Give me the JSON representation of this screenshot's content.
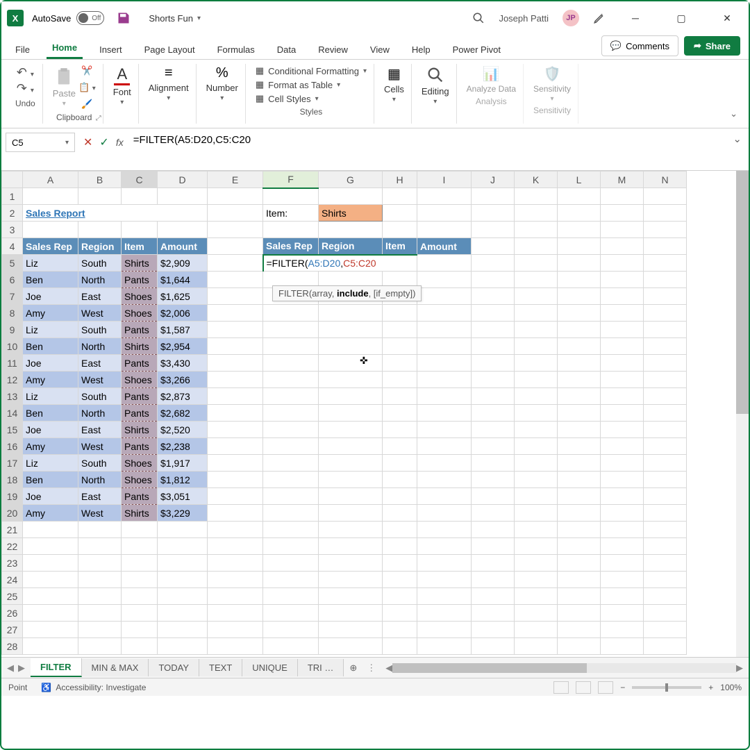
{
  "titlebar": {
    "autosave_label": "AutoSave",
    "autosave_state": "Off",
    "doc_name": "Shorts Fun",
    "user_name": "Joseph Patti",
    "user_initials": "JP"
  },
  "tabs": {
    "items": [
      "File",
      "Home",
      "Insert",
      "Page Layout",
      "Formulas",
      "Data",
      "Review",
      "View",
      "Help",
      "Power Pivot"
    ],
    "active": "Home",
    "comments": "Comments",
    "share": "Share"
  },
  "ribbon": {
    "undo": "Undo",
    "clipboard": "Clipboard",
    "paste": "Paste",
    "font": "Font",
    "alignment": "Alignment",
    "number": "Number",
    "styles": "Styles",
    "cond_format": "Conditional Formatting",
    "format_table": "Format as Table",
    "cell_styles": "Cell Styles",
    "cells": "Cells",
    "editing": "Editing",
    "analyze": "Analyze Data",
    "analysis": "Analysis",
    "sensitivity": "Sensitivity"
  },
  "formula_bar": {
    "name_box": "C5",
    "formula_prefix": "=FILTER(",
    "formula_arg1": "A5:D20",
    "formula_comma": ",",
    "formula_arg2": "C5:C20",
    "tooltip_fn": "FILTER",
    "tooltip_sig_pre": "(array, ",
    "tooltip_sig_bold": "include",
    "tooltip_sig_post": ", [if_empty])"
  },
  "grid": {
    "columns": [
      "A",
      "B",
      "C",
      "D",
      "E",
      "F",
      "G",
      "H",
      "I",
      "J",
      "K",
      "L",
      "M",
      "N"
    ],
    "title": "Sales Report",
    "item_label": "Item:",
    "item_value": "Shirts",
    "headers": [
      "Sales Rep",
      "Region",
      "Item",
      "Amount"
    ],
    "headers2": [
      "Sales Rep",
      "Region",
      "Item",
      "Amount"
    ],
    "rows": [
      {
        "rep": "Liz",
        "region": "South",
        "item": "Shirts",
        "amount": "$2,909"
      },
      {
        "rep": "Ben",
        "region": "North",
        "item": "Pants",
        "amount": "$1,644"
      },
      {
        "rep": "Joe",
        "region": "East",
        "item": "Shoes",
        "amount": "$1,625"
      },
      {
        "rep": "Amy",
        "region": "West",
        "item": "Shoes",
        "amount": "$2,006"
      },
      {
        "rep": "Liz",
        "region": "South",
        "item": "Pants",
        "amount": "$1,587"
      },
      {
        "rep": "Ben",
        "region": "North",
        "item": "Shirts",
        "amount": "$2,954"
      },
      {
        "rep": "Joe",
        "region": "East",
        "item": "Pants",
        "amount": "$3,430"
      },
      {
        "rep": "Amy",
        "region": "West",
        "item": "Shoes",
        "amount": "$3,266"
      },
      {
        "rep": "Liz",
        "region": "South",
        "item": "Pants",
        "amount": "$2,873"
      },
      {
        "rep": "Ben",
        "region": "North",
        "item": "Pants",
        "amount": "$2,682"
      },
      {
        "rep": "Joe",
        "region": "East",
        "item": "Shirts",
        "amount": "$2,520"
      },
      {
        "rep": "Amy",
        "region": "West",
        "item": "Pants",
        "amount": "$2,238"
      },
      {
        "rep": "Liz",
        "region": "South",
        "item": "Shoes",
        "amount": "$1,917"
      },
      {
        "rep": "Ben",
        "region": "North",
        "item": "Shoes",
        "amount": "$1,812"
      },
      {
        "rep": "Joe",
        "region": "East",
        "item": "Pants",
        "amount": "$3,051"
      },
      {
        "rep": "Amy",
        "region": "West",
        "item": "Shirts",
        "amount": "$3,229"
      }
    ]
  },
  "sheets": {
    "tabs": [
      "FILTER",
      "MIN & MAX",
      "TODAY",
      "TEXT",
      "UNIQUE",
      "TRI  …"
    ],
    "active": "FILTER"
  },
  "status": {
    "mode": "Point",
    "accessibility": "Accessibility: Investigate",
    "zoom": "100%"
  }
}
